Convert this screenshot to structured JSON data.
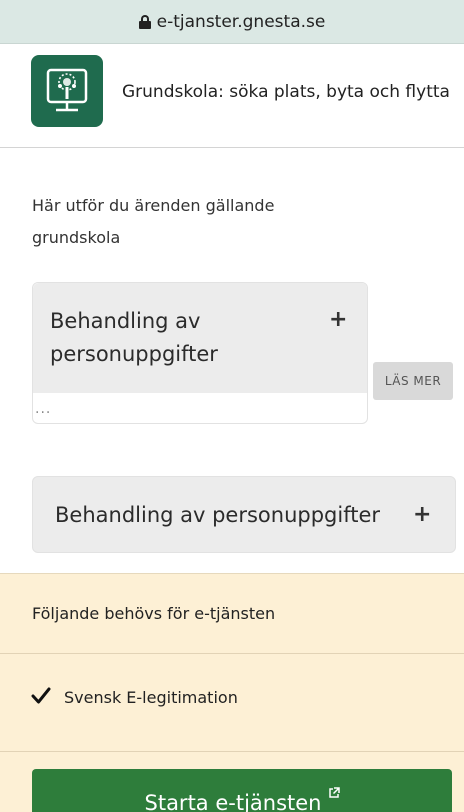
{
  "browser": {
    "url": "e-tjanster.gnesta.se"
  },
  "header": {
    "title": "Grundskola: söka plats, byta och flytta"
  },
  "intro": {
    "text": "Här utför du ärenden gällande grundskola"
  },
  "accordion1": {
    "title": "Behandling av personuppgifter",
    "expand_icon": "plus-icon",
    "preview": "..."
  },
  "read_more": {
    "label": "LÄS MER"
  },
  "accordion2": {
    "title": "Behandling av personuppgifter",
    "expand_icon": "plus-icon"
  },
  "requirements": {
    "title": "Följande behövs för e-tjänsten",
    "items": [
      {
        "label": "Svensk E-legitimation",
        "icon": "checkmark-icon"
      }
    ]
  },
  "start_button": {
    "label": "Starta e-tjänsten",
    "icon": "external-link-icon"
  },
  "colors": {
    "brand_green": "#1f6b4e",
    "button_green": "#2e7d3b",
    "requirements_bg": "#fdf0d5",
    "urlbar_bg": "#dbe8e4"
  }
}
